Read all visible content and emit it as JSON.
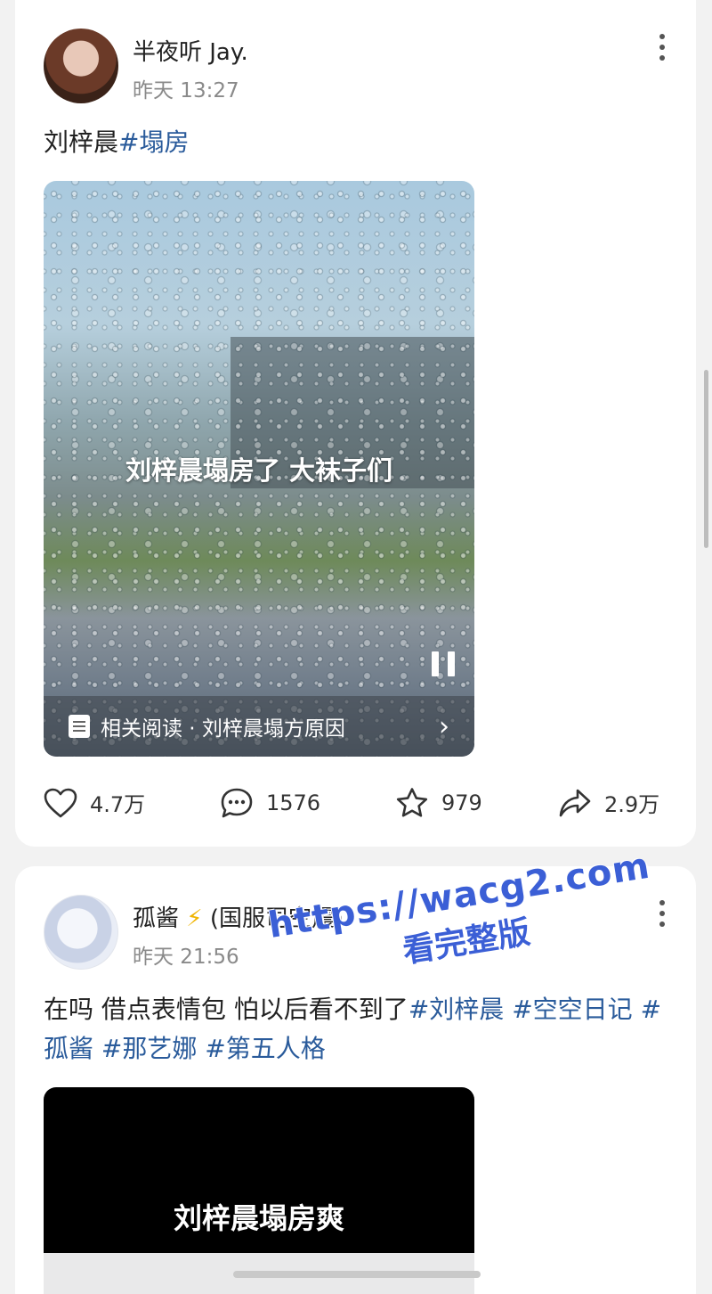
{
  "posts": [
    {
      "author": "半夜听 Jay.",
      "time": "昨天 13:27",
      "text_plain": "刘梓晨",
      "text_tag": "#塌房",
      "media": {
        "overlay_text": "刘梓晨塌房了 大袜子们",
        "related_label": "相关阅读 · 刘梓晨塌方原因"
      },
      "actions": {
        "likes": "4.7万",
        "comments": "1576",
        "favorites": "979",
        "shares": "2.9万"
      }
    },
    {
      "author_name": "孤酱",
      "author_suffix": "(国服司空震)",
      "time": "昨天 21:56",
      "text_plain": "在吗 借点表情包 怕以后看不到了",
      "tags": [
        "#刘梓晨",
        "#空空日记",
        "#孤酱",
        "#那艺娜",
        "#第五人格"
      ],
      "media": {
        "overlay_text": "刘梓晨塌房爽"
      }
    }
  ],
  "watermark": {
    "line1": "https://wacg2.com",
    "line2": "看完整版"
  },
  "icons": {
    "like": "heart-icon",
    "comment": "comment-bubble-icon",
    "favorite": "star-icon",
    "share": "share-arrow-icon",
    "more": "more-vertical-icon",
    "pause": "pause-icon",
    "related": "document-icon",
    "bolt": "lightning-icon"
  },
  "colors": {
    "tag": "#2a5b9b",
    "watermark": "#3b5fd6"
  }
}
